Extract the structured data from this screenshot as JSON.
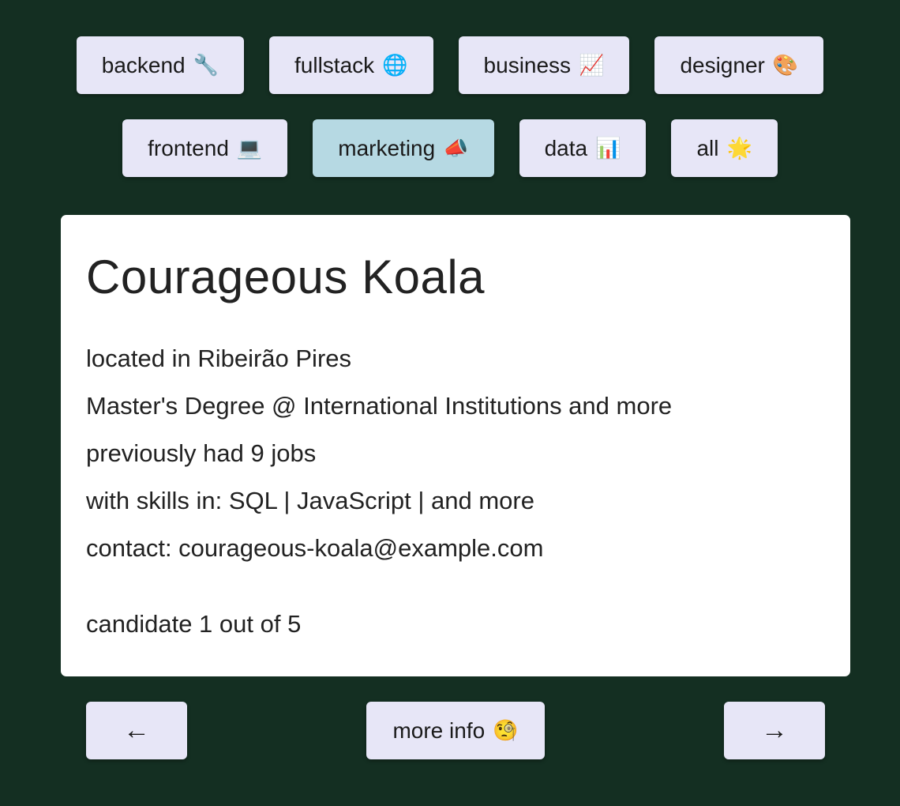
{
  "filters": {
    "row1": [
      {
        "label": "backend",
        "emoji": "🔧"
      },
      {
        "label": "fullstack",
        "emoji": "🌐"
      },
      {
        "label": "business",
        "emoji": "📈"
      },
      {
        "label": "designer",
        "emoji": "🎨"
      }
    ],
    "row2": [
      {
        "label": "frontend",
        "emoji": "💻"
      },
      {
        "label": "marketing",
        "emoji": "📣"
      },
      {
        "label": "data",
        "emoji": "📊"
      },
      {
        "label": "all",
        "emoji": "🌟"
      }
    ],
    "active": "marketing"
  },
  "candidate": {
    "name": "Courageous Koala",
    "location": "located in Ribeirão Pires",
    "education": "Master's Degree @ International Institutions and more",
    "jobs": "previously had 9 jobs",
    "skills": "with skills in: SQL | JavaScript | and more",
    "contact": "contact: courageous-koala@example.com",
    "counter": "candidate 1 out of 5"
  },
  "nav": {
    "prev_label": "←",
    "more_label": "more info",
    "more_emoji": "🧐",
    "next_label": "→"
  },
  "colors": {
    "background": "#142f22",
    "button": "#e7e6f7",
    "active_button": "#b6d9e3",
    "card": "#ffffff"
  }
}
